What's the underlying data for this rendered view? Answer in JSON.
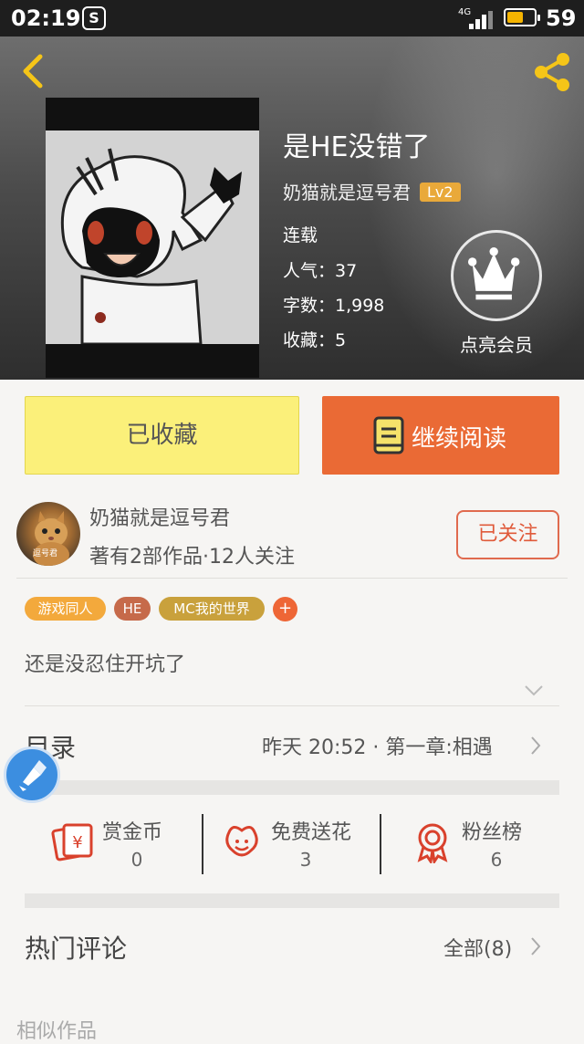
{
  "status_bar": {
    "time": "02:19",
    "network": "4G",
    "battery": "59",
    "battery_level": 0.59
  },
  "header": {
    "book_title": "是HE没错了",
    "author": "奶猫就是逗号君",
    "level": "Lv2",
    "status": "连载",
    "popularity": "人气：37",
    "word_count": "字数：1,998",
    "favorites": "收藏：5",
    "vip_label": "点亮会员"
  },
  "actions": {
    "favorited_label": "已收藏",
    "continue_label": "继续阅读"
  },
  "author_info": {
    "name": "奶猫就是逗号君",
    "stats": "著有2部作品·12人关注",
    "follow_label": "已关注",
    "avatar_caption": "逗号君"
  },
  "tags": [
    {
      "label": "游戏同人",
      "color": "#f3a93c"
    },
    {
      "label": "HE",
      "color": "#c66a4a"
    },
    {
      "label": "MC我的世界",
      "color": "#c9a13c"
    }
  ],
  "tag_add_label": "+",
  "description": "还是没忍住开坑了",
  "toc": {
    "label": "目录",
    "latest": "昨天 20:52 · 第一章:相遇"
  },
  "stats": [
    {
      "name": "赏金币",
      "value": "0",
      "icon": "reward-coin-icon"
    },
    {
      "name": "免费送花",
      "value": "3",
      "icon": "flower-icon"
    },
    {
      "name": "粉丝榜",
      "value": "6",
      "icon": "fan-ranking-icon"
    }
  ],
  "comments": {
    "label": "热门评论",
    "all_label": "全部(8)"
  },
  "similar_label": "相似作品",
  "colors": {
    "accent_orange": "#ea6a35",
    "favorite_yellow": "#fbf07a",
    "icon_red": "#d9412c"
  }
}
